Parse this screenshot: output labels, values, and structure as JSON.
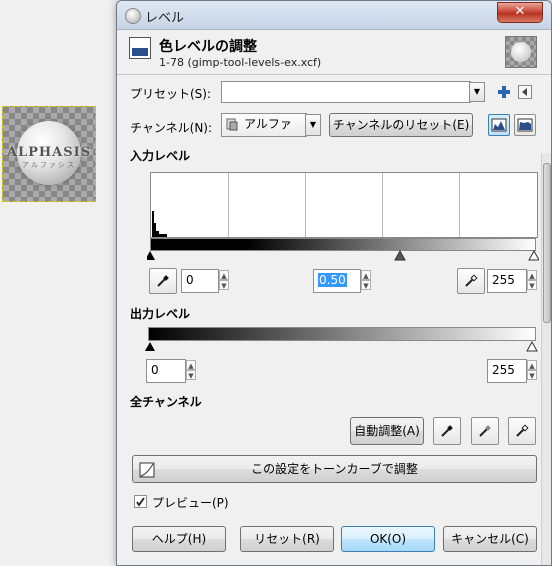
{
  "thumbnail": {
    "logo_text": "ALPHASIS",
    "logo_sub": "アルファシス"
  },
  "window": {
    "title": "レベル",
    "close_label": "✕"
  },
  "header": {
    "title": "色レベルの調整",
    "subtitle": "1-78 (gimp-tool-levels-ex.xcf)"
  },
  "preset": {
    "label": "プリセット(S):",
    "value": "",
    "add_icon": "plus-icon",
    "menu_icon": "menu-arrow-icon"
  },
  "channel": {
    "label": "チャンネル(N):",
    "selected": "アルファ",
    "reset_label": "チャンネルのリセット(E)",
    "linear_icon": "linear-histogram-icon",
    "log_icon": "log-histogram-icon"
  },
  "input_levels": {
    "section_label": "入力レベル",
    "low_value": "0",
    "gamma_value": "0.50",
    "high_value": "255"
  },
  "output_levels": {
    "section_label": "出力レベル",
    "low_value": "0",
    "high_value": "255"
  },
  "all_channels": {
    "section_label": "全チャンネル",
    "auto_label": "自動調整(A)"
  },
  "curves_button": {
    "label": "この設定をトーンカーブで調整"
  },
  "preview": {
    "label": "プレビュー(P)",
    "checked": true
  },
  "buttons": {
    "help": "ヘルプ(H)",
    "reset": "リセット(R)",
    "ok": "OK(O)",
    "cancel": "キャンセル(C)"
  },
  "colors": {
    "accent": "#3c7fb1",
    "selection": "#3399ff",
    "close": "#c8493a"
  }
}
